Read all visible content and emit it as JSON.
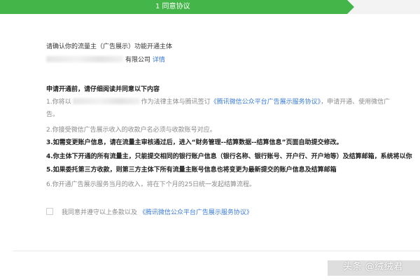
{
  "progress": {
    "step_label": "1 同意协议",
    "accent": "#44b549"
  },
  "intro": {
    "title": "请确认你的流量主（广告展示）功能开通主体",
    "subject_suffix": "有限公司",
    "detail_link": "详情"
  },
  "terms": {
    "heading": "申请开通前，请仔细阅读并同意以下内容",
    "c1_start": "1.你将以",
    "c1_mid": "作为法律主体与腾讯签订",
    "c1_link": "《腾讯微信公众平台广告展示服务协议》",
    "c1_end": "，申请开通、使用微信广",
    "c1_cont": "告。",
    "c2": "2.你接受微信广告展示收入的收款户名必须与收款账号对应。",
    "c3": "3.如需变更账户信息，请在流量主审核通过后，进入“财务管理--结算数据--结算信息”页面自助提交修改。",
    "c4": "4.你主体下开通的所有流量主，只能提交相同的银行账户信息（银行名称、银行账号、开户行、开户地等）及结算邮箱，系统将以你",
    "c5": "5.如果委托第三方收款，则第三方主体下所有流量主账号信息也将变更为最新提交的账户信息及结算邮箱",
    "c6": "6.你开通广告展示服务当月的收入，将在下个月的25日统一发起结算流程。"
  },
  "agreement": {
    "label": "我同意并遵守以上条款以及",
    "link": "《腾讯微信公众平台广告展示服务协议》"
  },
  "watermark": {
    "text": "头条 @绒绒君"
  },
  "colors": {
    "link": "#3a7bd5",
    "muted": "#8a8a8a"
  }
}
